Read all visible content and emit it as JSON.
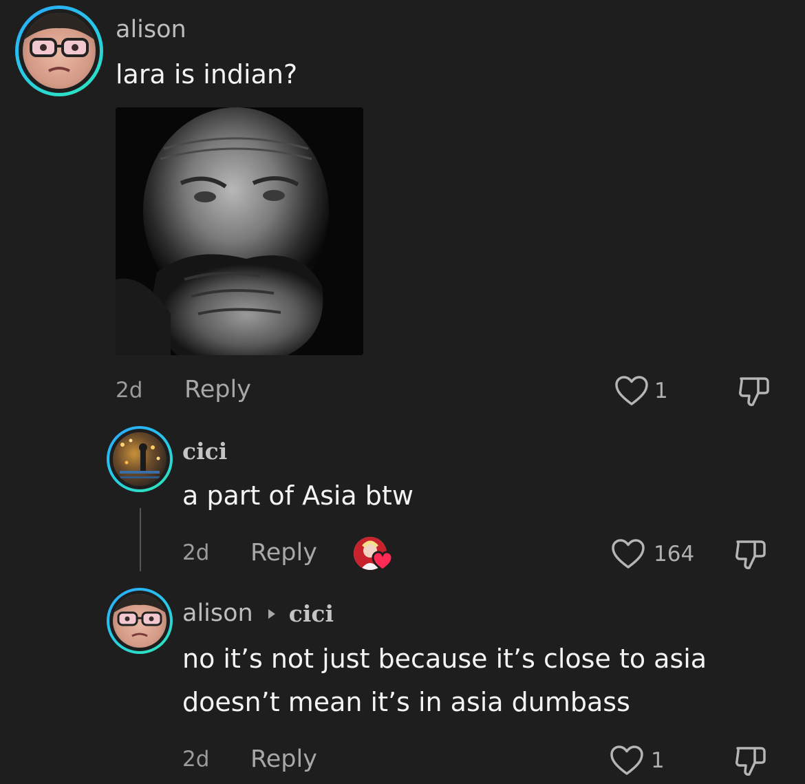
{
  "comments": [
    {
      "username": "alison",
      "text": "lara is indian?",
      "time": "2d",
      "reply_label": "Reply",
      "likes": "1"
    },
    {
      "username": "cici",
      "text": "a part of Asia btw",
      "time": "2d",
      "reply_label": "Reply",
      "likes": "164"
    },
    {
      "username": "alison",
      "reply_to": "cici",
      "text_lines": [
        "no it’s not just because it’s close to asia",
        "doesn’t mean it’s in asia dumbass"
      ],
      "time": "2d",
      "reply_label": "Reply",
      "likes": "1"
    }
  ],
  "icons": {
    "like": "heart-outline-icon",
    "dislike": "thumbs-down-icon",
    "creator_liked": "creator-liked-heart-badge"
  },
  "colors": {
    "background": "#1e1e1e",
    "avatar_ring_start": "#2aa8ff",
    "avatar_ring_end": "#2ee8b6",
    "heart_badge": "#ff2b55"
  }
}
